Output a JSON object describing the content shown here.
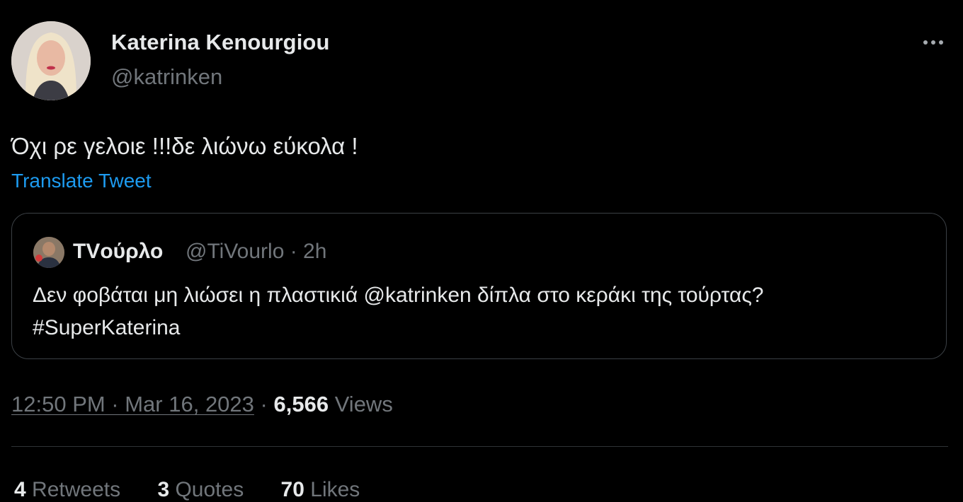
{
  "author": {
    "name": "Katerina Kenourgiou",
    "handle": "@katrinken"
  },
  "tweet": {
    "text": "Όχι ρε γελοιε !!!δε λιώνω εύκολα !",
    "translate_label": "Translate Tweet"
  },
  "quoted_tweet": {
    "name": "TVούρλο",
    "handle_time": "@TiVourlo · 2h",
    "text_line1": "Δεν φοβάται μη λιώσει η πλαστικιά @katrinken δίπλα στο κεράκι της τούρτας?",
    "text_line2": "#SuperKaterina"
  },
  "meta": {
    "time_date": "12:50 PM · Mar 16, 2023",
    "separator": " · ",
    "views_count": "6,566",
    "views_label": "Views"
  },
  "stats": {
    "retweets_count": "4",
    "retweets_label": "Retweets",
    "quotes_count": "3",
    "quotes_label": "Quotes",
    "likes_count": "70",
    "likes_label": "Likes"
  },
  "icons": {
    "more": "more-horizontal-icon"
  }
}
